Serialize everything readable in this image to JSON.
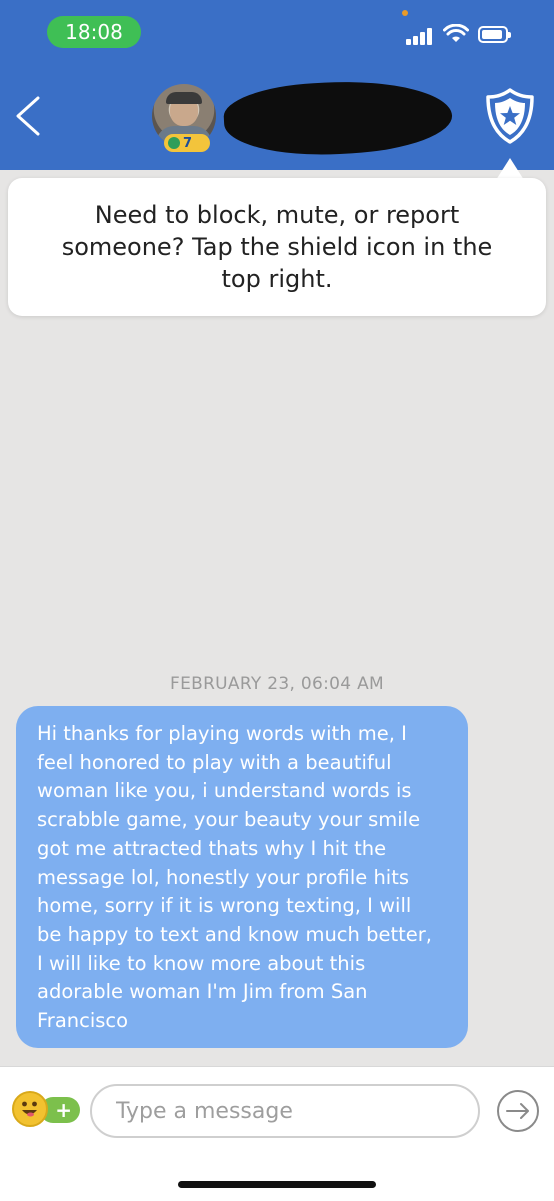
{
  "status_bar": {
    "time": "18:08"
  },
  "header": {
    "back_icon": "chevron-left-icon",
    "level": "7",
    "shield_icon": "shield-star-icon"
  },
  "tooltip": {
    "text": "Need to block, mute, or report someone? Tap the shield icon in the top right."
  },
  "conversation": {
    "date_label": "FEBRUARY 23, 06:04 AM",
    "messages": [
      {
        "text": "Hi thanks for playing words with me, I\nfeel honored to play with a beautiful\nwoman like you, i understand words is\nscrabble game, your beauty your smile\ngot me  attracted thats why I hit the\nmessage lol, honestly your profile hits\nhome, sorry if it is wrong texting, I will\nbe happy to text and know much better,\nI will like to know more about this\nadorable woman I'm Jim from San\nFrancisco",
        "color": "#7eaff0"
      }
    ]
  },
  "composer": {
    "placeholder": "Type a message",
    "value": "",
    "emoji_icon": "emoji-plus-icon",
    "send_icon": "send-arrow-icon"
  },
  "colors": {
    "header": "#3a6fc6",
    "background": "#e6e5e4",
    "bubble": "#7eaff0",
    "time_pill": "#3fbf55"
  }
}
